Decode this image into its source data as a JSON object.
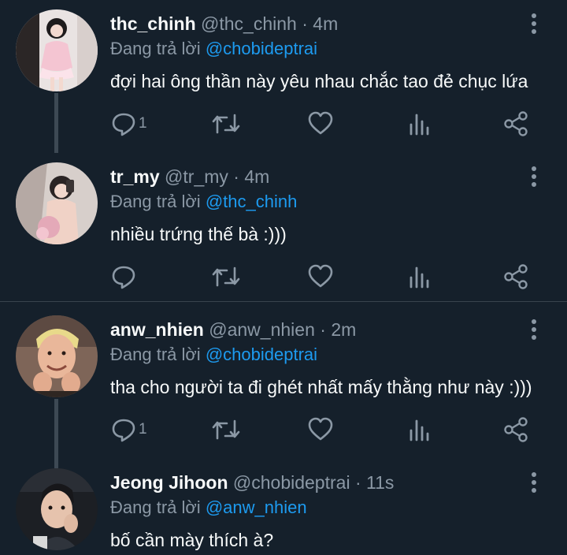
{
  "reply_prefix": "Đang trả lời",
  "tweets": [
    {
      "name": "thc_chinh",
      "handle": "@thc_chinh",
      "dot": "·",
      "time": "4m",
      "reply_to": "@chobideptrai",
      "text": "đợi hai ông thần này yêu nhau chắc tao đẻ chục lứa",
      "reply_count": "1"
    },
    {
      "name": "tr_my",
      "handle": "@tr_my",
      "dot": "·",
      "time": "4m",
      "reply_to": "@thc_chinh",
      "text": "nhiều trứng thế bà :)))",
      "reply_count": ""
    },
    {
      "name": "anw_nhien",
      "handle": "@anw_nhien",
      "dot": "·",
      "time": "2m",
      "reply_to": "@chobideptrai",
      "text": "tha cho người ta đi ghét nhất mấy thằng như này :)))",
      "reply_count": "1"
    },
    {
      "name": "Jeong Jihoon",
      "handle": "@chobideptrai",
      "dot": "·",
      "time": "11s",
      "reply_to": "@anw_nhien",
      "text": "bố cần mày thích à?",
      "reply_count": ""
    }
  ],
  "colors": {
    "background": "#15202b",
    "muted": "#8b98a5",
    "link": "#1d9bf0",
    "thread_line": "#3d4954"
  }
}
